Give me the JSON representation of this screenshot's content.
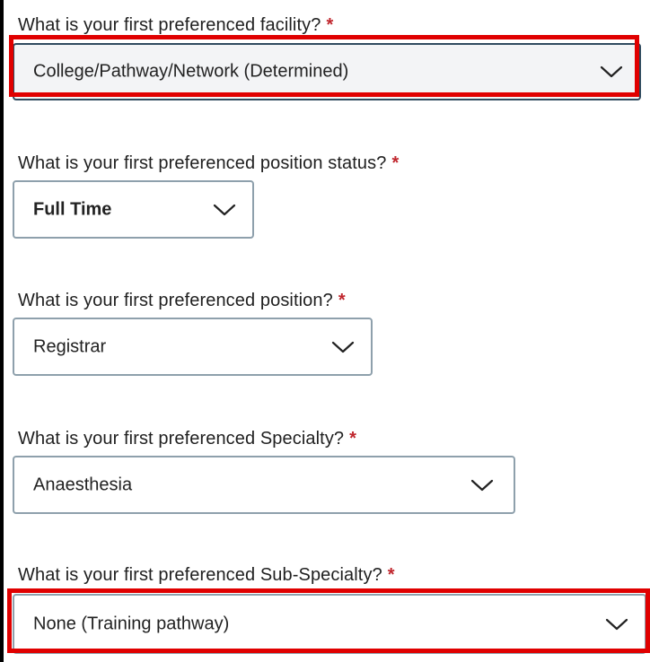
{
  "form": {
    "questions": [
      {
        "label": "What is your first preferenced facility?",
        "required_mark": "*",
        "selected": "College/Pathway/Network (Determined)",
        "chevron_icon": "chevron-down-icon"
      },
      {
        "label": "What is your first preferenced position status?",
        "required_mark": "*",
        "selected": "Full Time",
        "chevron_icon": "chevron-down-icon"
      },
      {
        "label": "What is your first preferenced position?",
        "required_mark": "*",
        "selected": "Registrar",
        "chevron_icon": "chevron-down-icon"
      },
      {
        "label": "What is your first preferenced Specialty?",
        "required_mark": "*",
        "selected": "Anaesthesia",
        "chevron_icon": "chevron-down-icon"
      },
      {
        "label": "What is your first preferenced Sub-Specialty?",
        "required_mark": "*",
        "selected": "None (Training pathway)",
        "chevron_icon": "chevron-down-icon"
      }
    ]
  },
  "colors": {
    "required_asterisk": "#c0262d",
    "highlight_box": "#e00000",
    "select_border": "#8ea0ac",
    "focused_select_border": "#2f4a5e"
  }
}
